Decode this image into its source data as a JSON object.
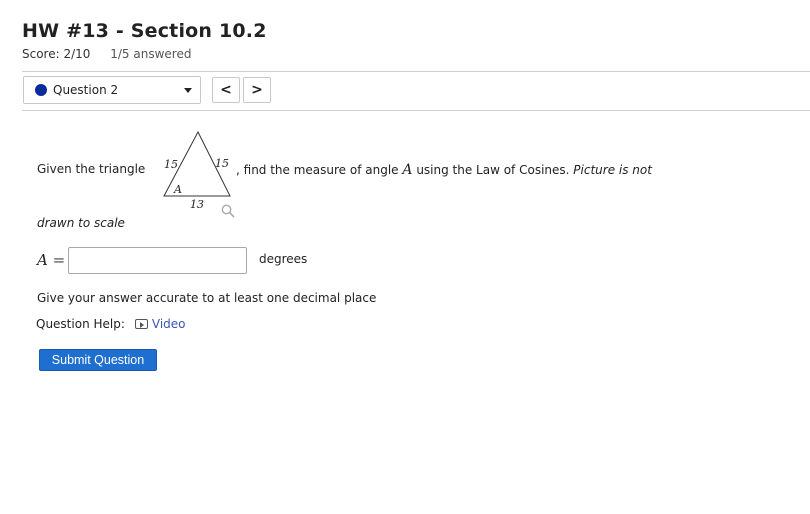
{
  "header": {
    "title": "HW #13 - Section 10.2",
    "score": "Score: 2/10",
    "answered": "1/5 answered"
  },
  "navigation": {
    "question_selector": "Question 2",
    "status_color": "#0b2a9b",
    "prev_label": "<",
    "next_label": ">"
  },
  "question": {
    "given_text": "Given the triangle",
    "triangle": {
      "side_left": "15",
      "side_right": "15",
      "side_bottom": "13",
      "angle_label": "A"
    },
    "text_after_triangle": ", find the measure of angle ",
    "angle_var": "A",
    "text_method": " using the Law of Cosines. ",
    "note_start": "Picture is not",
    "note_continued": "drawn to scale"
  },
  "answer": {
    "variable": "A",
    "equals": "=",
    "value": "",
    "unit": "degrees"
  },
  "instruction": "Give your answer accurate to at least one decimal place",
  "help": {
    "label": "Question Help:",
    "video_label": "Video"
  },
  "submit_label": "Submit Question",
  "colors": {
    "accent": "#1f6fd0",
    "link": "#3a55b4"
  }
}
